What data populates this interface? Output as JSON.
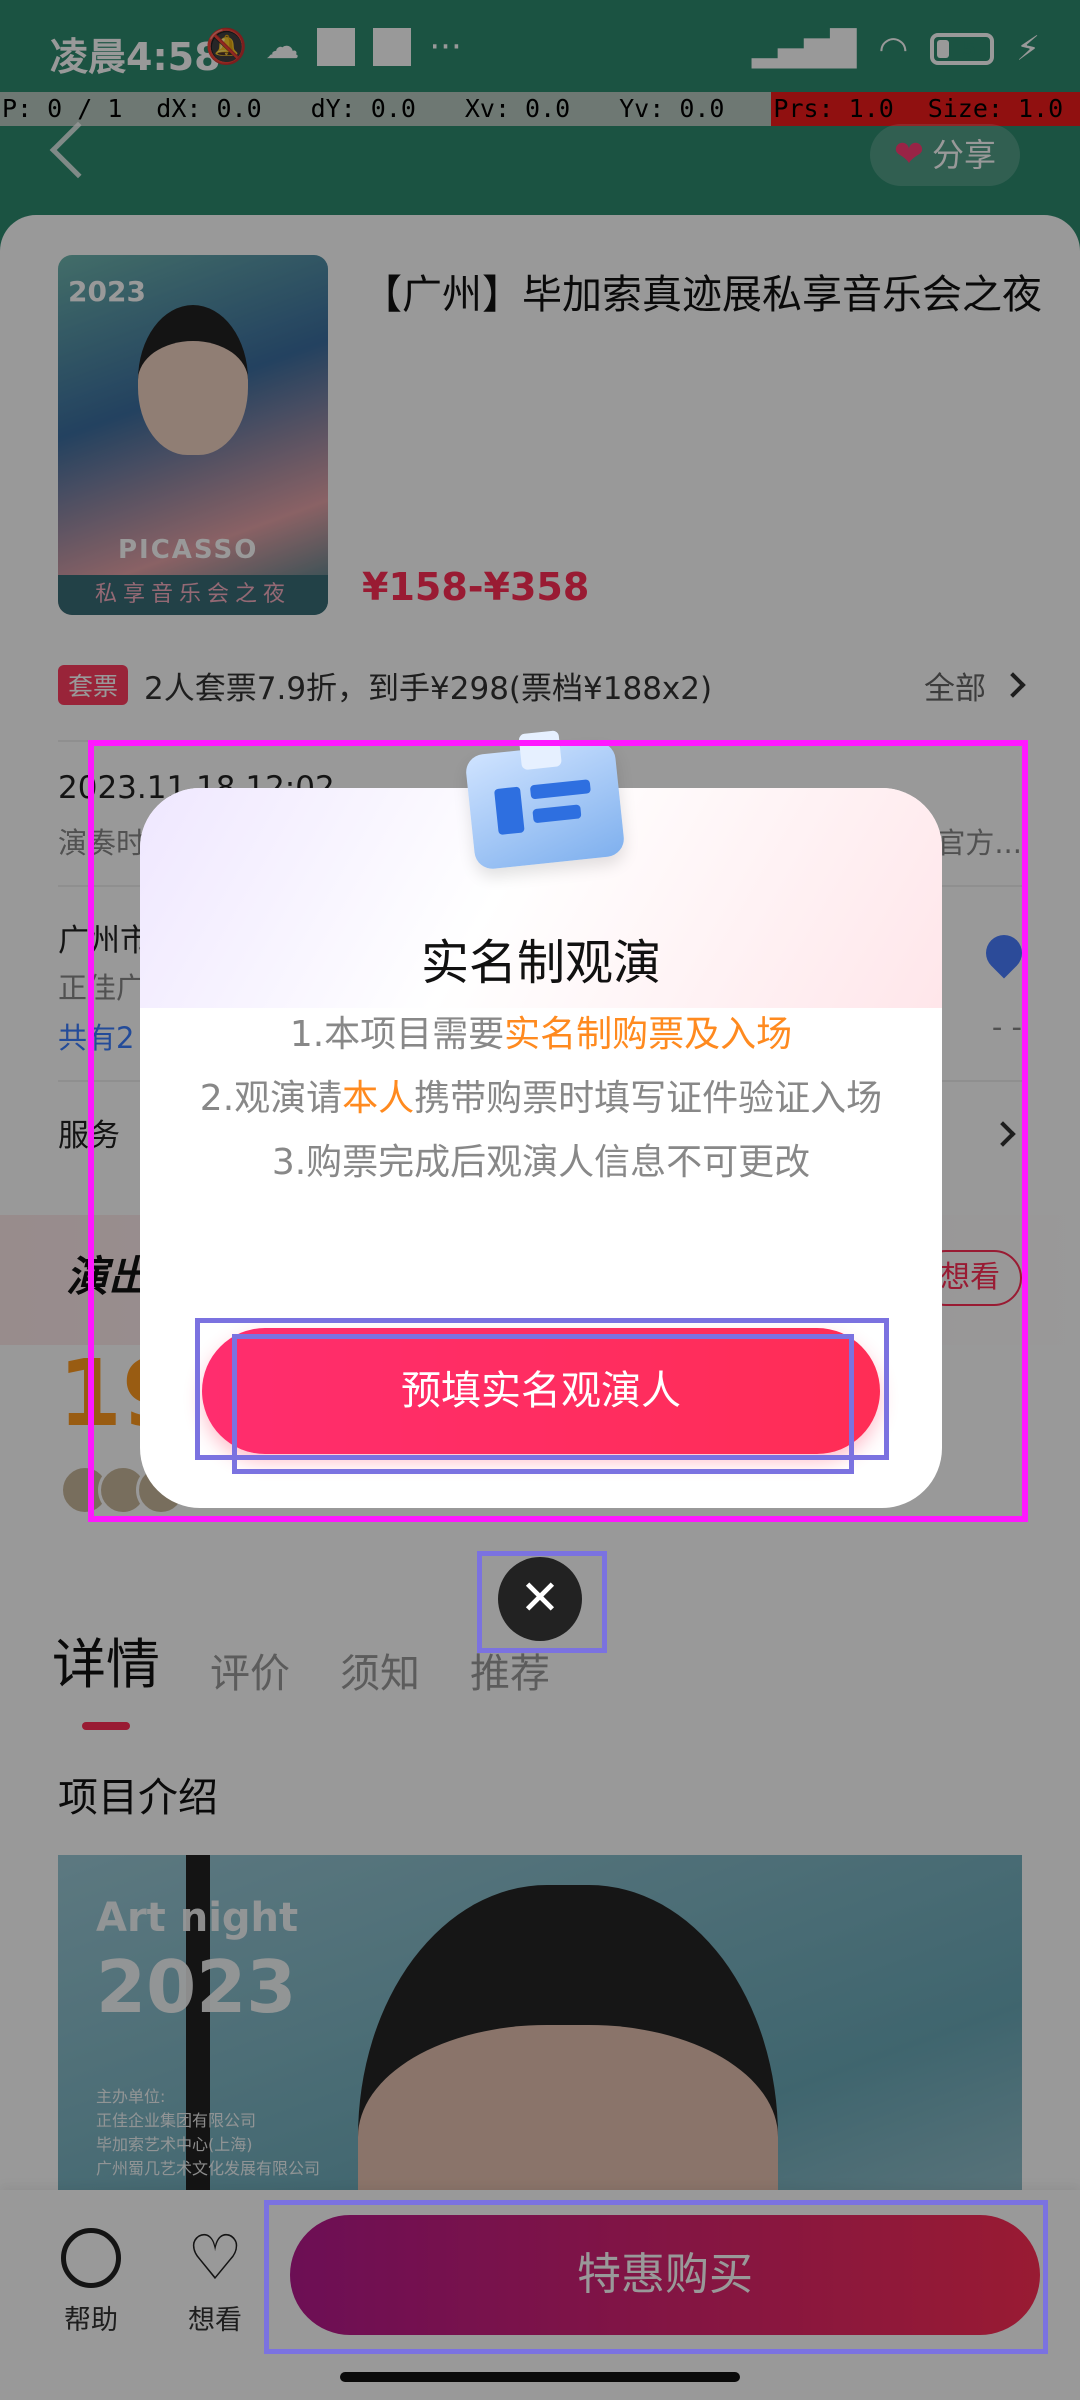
{
  "status_bar": {
    "time": "凌晨4:58",
    "left_icons": [
      "mute-icon",
      "cloud-icon",
      "square-icon",
      "square-icon",
      "more-icon"
    ],
    "right_icons": [
      "signal-icon",
      "wifi-icon",
      "battery-icon",
      "charging-icon"
    ],
    "battery_level": "5"
  },
  "pointer_bar": {
    "p": "P: 0 / 1",
    "dx": "dX: 0.0",
    "dy": "dY: 0.0",
    "xv": "Xv: 0.0",
    "yv": "Yv: 0.0",
    "prs": "Prs: 1.0",
    "size": "Size: 1.0"
  },
  "header": {
    "share_label": "分享"
  },
  "event": {
    "poster_year": "2023",
    "poster_name": "PICASSO",
    "poster_bottom": "私享音乐会之夜",
    "title": "【广州】毕加索真迹展私享音乐会之夜",
    "price": "¥158-¥358",
    "package_tag": "套票",
    "package_text": "2人套票7.9折，到手¥298(票档¥188x2)",
    "package_all": "全部",
    "date_text": "2023.11.18 12:02",
    "performer_text": "演奏时",
    "performer_right": "官方...",
    "venue_text": "广州市",
    "venue_sub": "正佳广",
    "venue_count": "共有2",
    "venue_right": "- -",
    "service_label": "服务",
    "promo_logo": "演出",
    "want_label": "想看",
    "promo_number": "19"
  },
  "tabs": [
    {
      "label": "详情",
      "active": true
    },
    {
      "label": "评价",
      "active": false
    },
    {
      "label": "须知",
      "active": false
    },
    {
      "label": "推荐",
      "active": false
    }
  ],
  "intro": {
    "title": "项目介绍",
    "art_label": "Art night",
    "art_year": "2023",
    "org_text": "主办单位:\n正佳企业集团有限公司\n毕加索艺术中心(上海)\n广州蜀几艺术文化发展有限公司\n—\n承办单位:\n蜀几艺术博物馆"
  },
  "bottom_bar": {
    "help_label": "帮助",
    "want_label": "想看",
    "buy_label": "特惠购买"
  },
  "modal": {
    "title": "实名制观演",
    "rule1_prefix": "1.本项目需要",
    "rule1_highlight": "实名制购票及入场",
    "rule2_prefix": "2.观演请",
    "rule2_highlight": "本人",
    "rule2_suffix": "携带购票时填写证件验证入场",
    "rule3": "3.购票完成后观演人信息不可更改",
    "button_label": "预填实名观演人",
    "close_symbol": "✕"
  },
  "colors": {
    "accent": "#ff2d55",
    "highlight": "#ff8a1f",
    "header_bg": "#2d8a6e",
    "debug_box": "#7b72e0",
    "debug_box_magenta": "#ff18ff"
  }
}
